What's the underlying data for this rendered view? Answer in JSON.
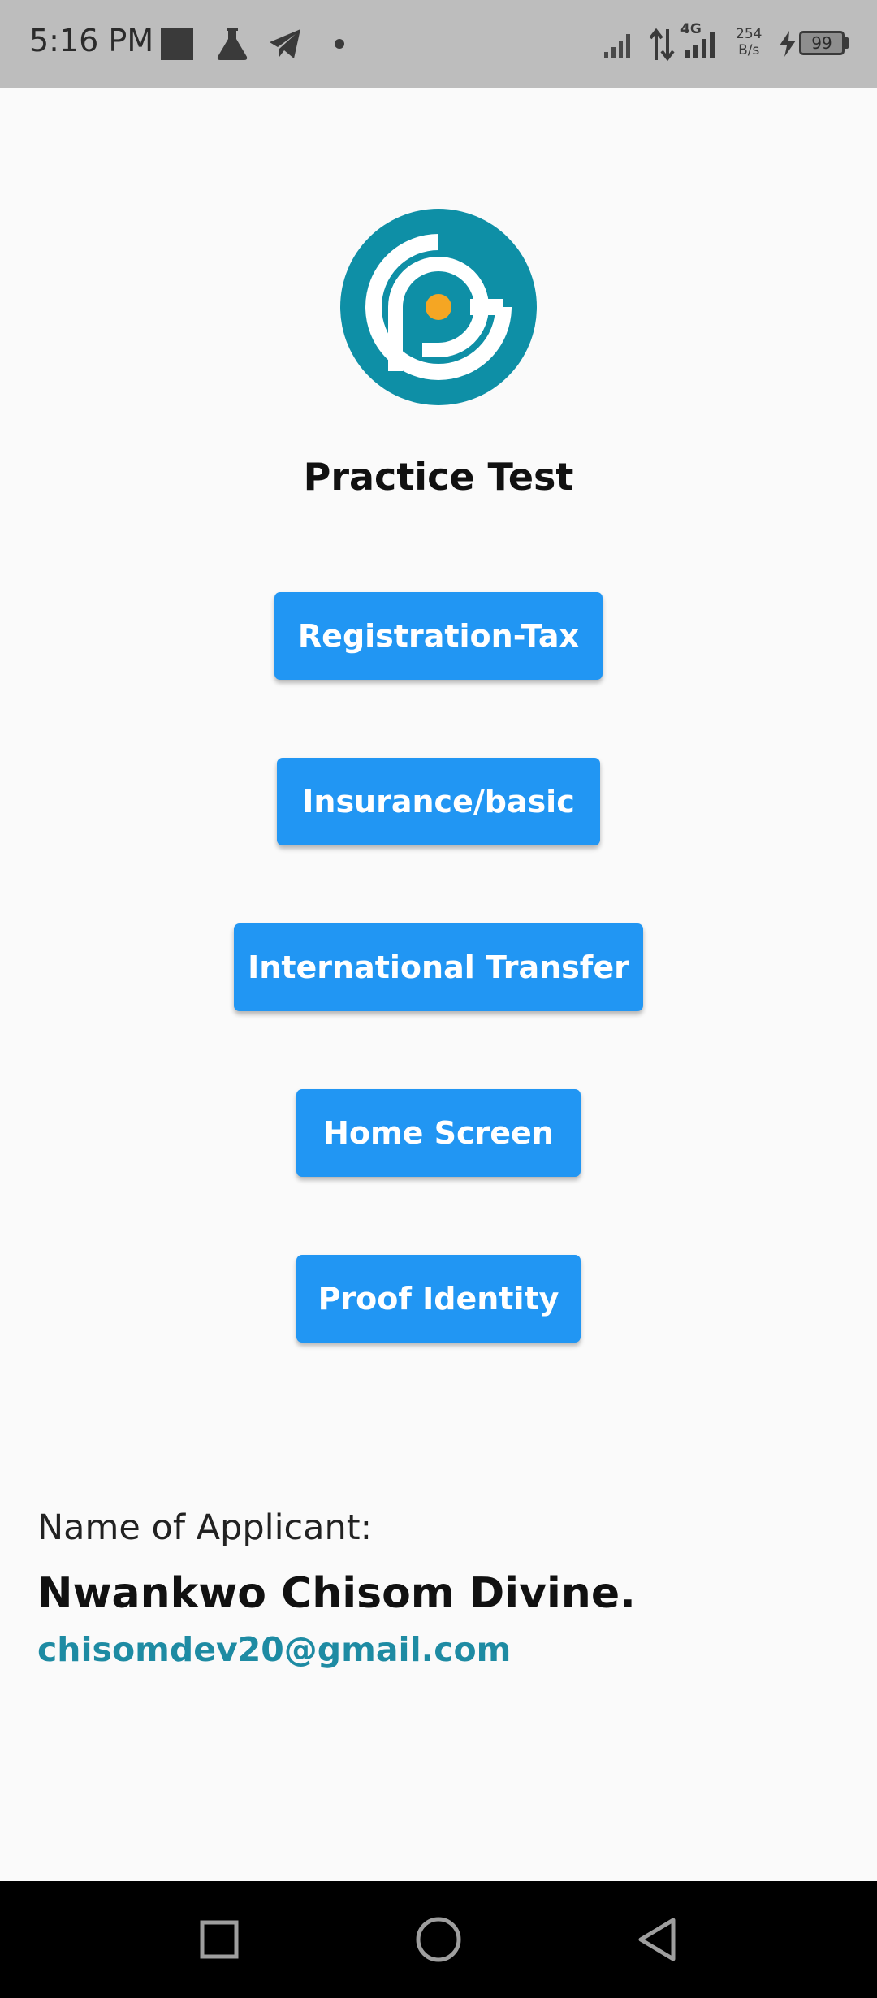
{
  "status_bar": {
    "time": "5:16 PM",
    "network": "4G",
    "speed_value": "254",
    "speed_unit": "B/s",
    "battery": "99",
    "icons": [
      "stop-icon",
      "flask-icon",
      "telegram-icon",
      "dot-icon",
      "signal-icon",
      "data-arrows-icon",
      "signal-4g-icon",
      "charging-icon",
      "battery-icon"
    ]
  },
  "header": {
    "title": "Practice Test",
    "logo_icon": "pg-logo-icon",
    "logo_color": "#0e8fa6",
    "logo_dot_color": "#f5a623"
  },
  "menu": {
    "button_color": "#2196f3",
    "buttons": [
      {
        "label": "Registration-Tax"
      },
      {
        "label": "Insurance/basic"
      },
      {
        "label": "International Transfer"
      },
      {
        "label": "Home Screen"
      },
      {
        "label": "Proof Identity"
      }
    ]
  },
  "applicant": {
    "label": "Name of Applicant:",
    "name": "Nwankwo Chisom Divine.",
    "email": "chisomdev20@gmail.com",
    "email_color": "#1e8ba3"
  },
  "nav_bar": {
    "buttons": [
      "recents-square-icon",
      "home-circle-icon",
      "back-triangle-icon"
    ]
  }
}
